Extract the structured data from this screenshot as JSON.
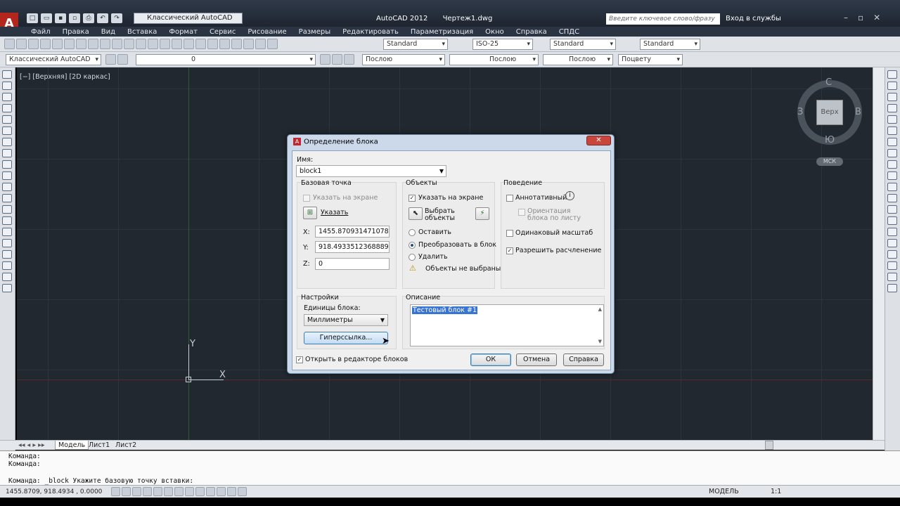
{
  "titlebar": {
    "workspace": "Классический AutoCAD",
    "app_title": "AutoCAD 2012",
    "file_title": "Чертеж1.dwg",
    "search_placeholder": "Введите ключевое слово/фразу",
    "signin": "Вход в службы"
  },
  "menu": [
    "Файл",
    "Правка",
    "Вид",
    "Вставка",
    "Формат",
    "Сервис",
    "Рисование",
    "Размеры",
    "Редактировать",
    "Параметризация",
    "Окно",
    "Справка",
    "СПДС"
  ],
  "toolbar1": {
    "text_style": "Standard",
    "dim_style": "ISO-25",
    "table_style": "Standard",
    "mleader_style": "Standard"
  },
  "toolbar2": {
    "workspace": "Классический AutoCAD",
    "layer": "0",
    "color": "Послою",
    "linetype": "Послою",
    "lineweight": "Послою",
    "plotstyle": "Поцвету"
  },
  "viewport": {
    "label": "[−] [Верхняя] [2D каркас]",
    "cube_top": "Верх",
    "north": "С",
    "south": "Ю",
    "west": "З",
    "east": "В",
    "wcs": "МСК",
    "ucs_x": "X",
    "ucs_y": "Y"
  },
  "tabs": [
    "Модель",
    "Лист1",
    "Лист2"
  ],
  "command": {
    "line1": "Команда:",
    "line2": "Команда:",
    "line3": "Команда:  _block Укажите базовую точку вставки:"
  },
  "status": {
    "coords": "1455.8709, 918.4934 , 0.0000",
    "model": "МОДЕЛЬ",
    "scale": "1:1"
  },
  "dialog": {
    "title": "Определение блока",
    "close": "✕",
    "name_label": "Имя:",
    "name_value": "block1",
    "base_point": {
      "title": "Базовая точка",
      "specify_on_screen": "Указать на экране",
      "pick": "Указать",
      "x_label": "X:",
      "x": "1455.870931471078",
      "y_label": "Y:",
      "y": "918.4933512368889",
      "z_label": "Z:",
      "z": "0"
    },
    "objects": {
      "title": "Объекты",
      "specify_on_screen": "Указать на экране",
      "select": "Выбрать объекты",
      "retain": "Оставить",
      "convert": "Преобразовать в блок",
      "delete": "Удалить",
      "warning": "Объекты не выбраны"
    },
    "behavior": {
      "title": "Поведение",
      "annotative": "Аннотативный",
      "match_orientation": "Ориентация блока по листу",
      "scale_uniformly": "Одинаковый масштаб",
      "allow_explode": "Разрешить расчленение"
    },
    "settings": {
      "title": "Настройки",
      "units_label": "Единицы блока:",
      "units": "Миллиметры",
      "hyperlink": "Гиперссылка..."
    },
    "description": {
      "title": "Описание",
      "text": "Тестовый блок #1"
    },
    "open_in_editor": "Открыть в редакторе блоков",
    "ok": "ОК",
    "cancel": "Отмена",
    "help": "Справка"
  }
}
